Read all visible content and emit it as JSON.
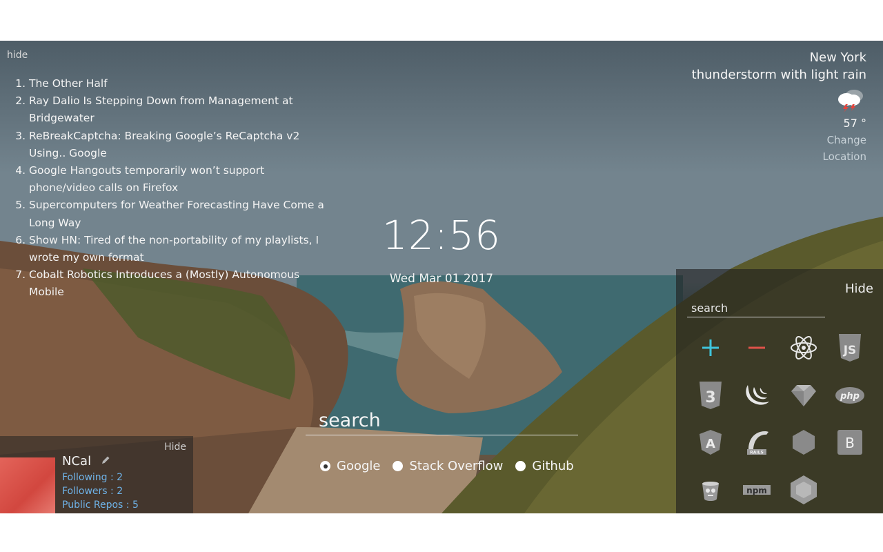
{
  "hacker_news": {
    "hide_label": "hide",
    "items": [
      "The Other Half",
      "Ray Dalio Is Stepping Down from Management at Bridgewater",
      "ReBreakCaptcha: Breaking Google’s ReCaptcha v2 Using.. Google",
      "Google Hangouts temporarily won’t support phone/video calls on Firefox",
      "Supercomputers for Weather Forecasting Have Come a Long Way",
      "Show HN: Tired of the non-portability of my playlists, I wrote my own format",
      "Cobalt Robotics Introduces a (Mostly) Autonomous Mobile"
    ]
  },
  "weather": {
    "city": "New York",
    "description": "thunderstorm with light rain",
    "icon": "thunderstorm-cloud-icon",
    "temperature": "57 °",
    "change_label_1": "Change",
    "change_label_2": "Location"
  },
  "clock": {
    "time": "12:56",
    "date": "Wed Mar 01 2017"
  },
  "search": {
    "placeholder": "search",
    "engines": [
      {
        "label": "Google",
        "selected": true
      },
      {
        "label": "Stack Overflow",
        "selected": false
      },
      {
        "label": "Github",
        "selected": false
      }
    ]
  },
  "github": {
    "hide_label": "Hide",
    "username": "NCal",
    "edit_icon": "pencil-icon",
    "following": "Following : 2",
    "followers": "Followers : 2",
    "public_repos": "Public Repos : 5"
  },
  "dev_panel": {
    "hide_label": "Hide",
    "search_placeholder": "search",
    "icons": [
      "add-icon",
      "remove-icon",
      "react-icon",
      "javascript-icon",
      "css3-icon",
      "jquery-icon",
      "ruby-icon",
      "php-icon",
      "angular-icon",
      "rails-icon",
      "nodejs-icon",
      "bootstrap-icon",
      "gulp-icon",
      "npm-icon",
      "nodejs-icon"
    ],
    "icon_texts": {
      "php": "php",
      "bootstrap": "B",
      "angular": "A",
      "npm": "npm",
      "rails": "RAILS",
      "js": "JS",
      "css": "3"
    },
    "accent_add": "#3fc4dc",
    "accent_remove": "#e0524a"
  }
}
